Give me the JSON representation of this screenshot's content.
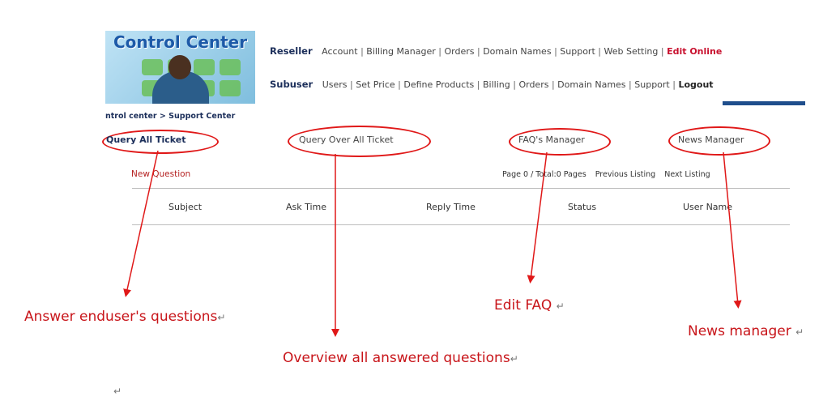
{
  "logo": {
    "title": "Control Center"
  },
  "nav": {
    "reseller": {
      "lead": "Reseller",
      "items": [
        "Account",
        "Billing Manager",
        "Orders",
        "Domain Names",
        "Support",
        "Web Setting"
      ],
      "highlight": "Edit Online"
    },
    "subuser": {
      "lead": "Subuser",
      "items": [
        "Users",
        "Set Price",
        "Define Products",
        "Billing",
        "Orders",
        "Domain Names",
        "Support"
      ],
      "final": "Logout"
    },
    "separator": "|"
  },
  "breadcrumb": "ntrol center > Support Center",
  "tabs": {
    "query_all": "Query All Ticket",
    "query_over_all": "Query Over All Ticket",
    "faq": "FAQ's Manager",
    "news": "News Manager"
  },
  "toolbar": {
    "new_question": "New Question",
    "page_info": "Page 0 / Total:0 Pages",
    "previous": "Previous Listing",
    "next": "Next Listing"
  },
  "table": {
    "columns": [
      "Subject",
      "Ask Time",
      "Reply Time",
      "Status",
      "User Name"
    ]
  },
  "annotations": {
    "answer": "Answer enduser's questions",
    "overview": "Overview all answered questions",
    "edit_faq": "Edit FAQ",
    "news": "News manager",
    "return_mark": "↵"
  },
  "colors": {
    "accent_red": "#c8151a",
    "nav_blue": "#1b2e5a",
    "bar_blue": "#1f4e8c"
  }
}
